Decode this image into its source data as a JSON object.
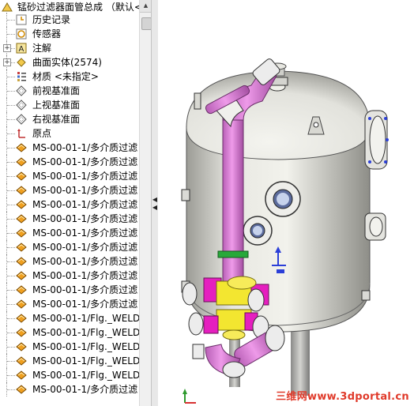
{
  "feature_tree": {
    "root": {
      "label": "锰砂过滤器面管总成 （默认<",
      "icon": "assembly-icon"
    },
    "items": [
      {
        "label": "历史记录",
        "icon": "history-icon",
        "expandable": false
      },
      {
        "label": "传感器",
        "icon": "sensor-icon",
        "expandable": false
      },
      {
        "label": "注解",
        "icon": "annotation-icon",
        "expandable": true
      },
      {
        "label": "曲面实体(2574)",
        "icon": "surface-bodies-icon",
        "expandable": true
      },
      {
        "label": "材质 <未指定>",
        "icon": "material-icon",
        "expandable": false
      },
      {
        "label": "前视基准面",
        "icon": "plane-icon",
        "expandable": false
      },
      {
        "label": "上视基准面",
        "icon": "plane-icon",
        "expandable": false
      },
      {
        "label": "右视基准面",
        "icon": "plane-icon",
        "expandable": false
      },
      {
        "label": "原点",
        "icon": "origin-icon",
        "expandable": false
      },
      {
        "label": "MS-00-01-1/多介质过滤",
        "icon": "part-feature-icon",
        "expandable": false
      },
      {
        "label": "MS-00-01-1/多介质过滤",
        "icon": "part-feature-icon",
        "expandable": false
      },
      {
        "label": "MS-00-01-1/多介质过滤",
        "icon": "part-feature-icon",
        "expandable": false
      },
      {
        "label": "MS-00-01-1/多介质过滤",
        "icon": "part-feature-icon",
        "expandable": false
      },
      {
        "label": "MS-00-01-1/多介质过滤",
        "icon": "part-feature-icon",
        "expandable": false
      },
      {
        "label": "MS-00-01-1/多介质过滤",
        "icon": "part-feature-icon",
        "expandable": false
      },
      {
        "label": "MS-00-01-1/多介质过滤",
        "icon": "part-feature-icon",
        "expandable": false
      },
      {
        "label": "MS-00-01-1/多介质过滤",
        "icon": "part-feature-icon",
        "expandable": false
      },
      {
        "label": "MS-00-01-1/多介质过滤",
        "icon": "part-feature-icon",
        "expandable": false
      },
      {
        "label": "MS-00-01-1/多介质过滤",
        "icon": "part-feature-icon",
        "expandable": false
      },
      {
        "label": "MS-00-01-1/多介质过滤",
        "icon": "part-feature-icon",
        "expandable": false
      },
      {
        "label": "MS-00-01-1/多介质过滤",
        "icon": "part-feature-icon",
        "expandable": false
      },
      {
        "label": "MS-00-01-1/Flg._WELDI",
        "icon": "part-feature-icon",
        "expandable": false
      },
      {
        "label": "MS-00-01-1/Flg._WELDI",
        "icon": "part-feature-icon",
        "expandable": false
      },
      {
        "label": "MS-00-01-1/Flg._WELDI",
        "icon": "part-feature-icon",
        "expandable": false
      },
      {
        "label": "MS-00-01-1/Flg._WELDI",
        "icon": "part-feature-icon",
        "expandable": false
      },
      {
        "label": "MS-00-01-1/Flg._WELDI",
        "icon": "part-feature-icon",
        "expandable": false
      },
      {
        "label": "MS-00-01-1/多介质过滤",
        "icon": "part-feature-icon",
        "expandable": false
      }
    ]
  },
  "watermark": "三维网www.3dportal.cn",
  "colors": {
    "tank": "#e4e4de",
    "pipe": "#d98ad8",
    "fitting_yellow": "#f3e630",
    "fitting_magenta": "#e51fbf",
    "blue_bolt": "#2b3fd8"
  }
}
